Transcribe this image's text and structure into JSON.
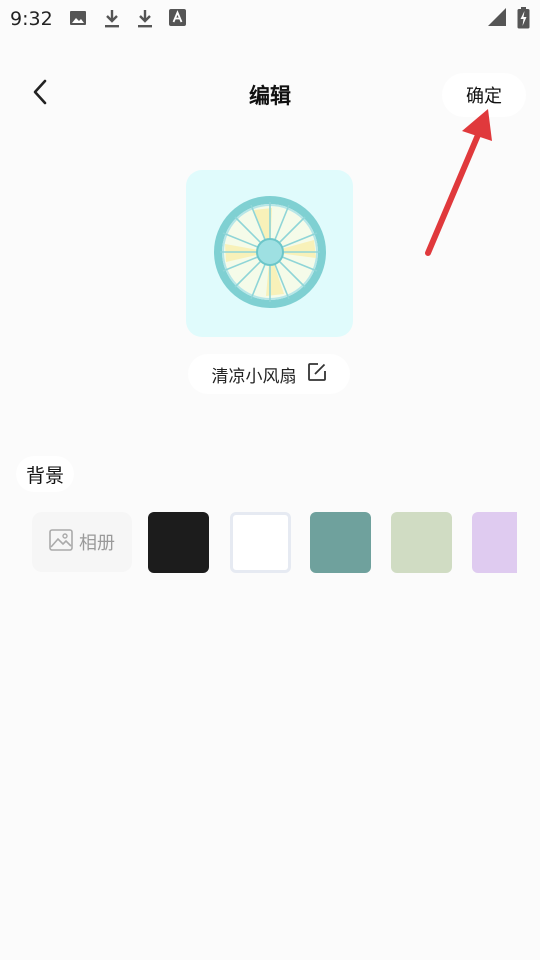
{
  "status_bar": {
    "time": "9:32",
    "left_icons": [
      "image-icon",
      "download-icon",
      "download-icon",
      "font-icon"
    ],
    "right_icons": [
      "signal-icon",
      "battery-charging-icon"
    ]
  },
  "header": {
    "title": "编辑",
    "confirm_label": "确定",
    "back_icon": "chevron-left-icon"
  },
  "widget": {
    "preview_icon": "fan-icon",
    "preview_bg": "#e0fbfc",
    "name": "清凉小风扇",
    "edit_icon": "edit-icon"
  },
  "background_section": {
    "label": "背景",
    "album_label": "相册",
    "album_icon": "image-icon",
    "swatches": [
      {
        "name": "black",
        "color": "#1c1c1c"
      },
      {
        "name": "white",
        "color": "#ffffff"
      },
      {
        "name": "teal",
        "color": "#6fa19d"
      },
      {
        "name": "sage",
        "color": "#d0dcc3"
      },
      {
        "name": "lavender",
        "color": "#dfcbf0"
      }
    ]
  },
  "annotation": {
    "arrow_color": "#e0393c"
  }
}
